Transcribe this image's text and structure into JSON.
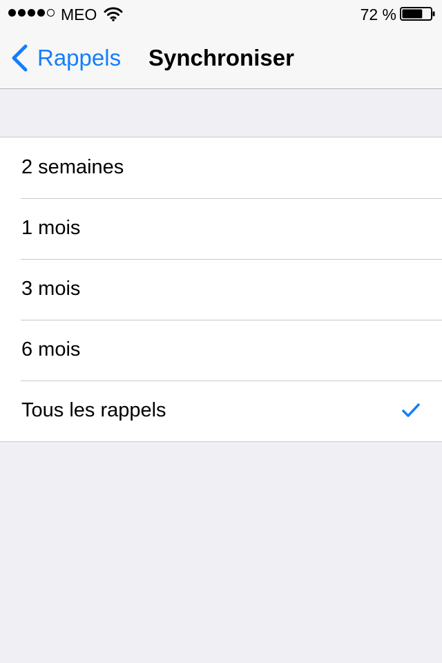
{
  "status_bar": {
    "signal_bars_filled": 4,
    "signal_bars_total": 5,
    "carrier": "MEO",
    "wifi_icon": "wifi-icon",
    "battery_percent": "72 %",
    "battery_level": 0.72
  },
  "nav": {
    "back_label": "Rappels",
    "back_icon": "chevron-left-icon",
    "title": "Synchroniser"
  },
  "sync_options": [
    {
      "label": "2 semaines",
      "selected": false
    },
    {
      "label": "1 mois",
      "selected": false
    },
    {
      "label": "3 mois",
      "selected": false
    },
    {
      "label": "6 mois",
      "selected": false
    },
    {
      "label": "Tous les rappels",
      "selected": true
    }
  ],
  "colors": {
    "accent": "#147efb",
    "background": "#efeff4",
    "cell": "#ffffff",
    "separator": "#c8c7cc"
  }
}
